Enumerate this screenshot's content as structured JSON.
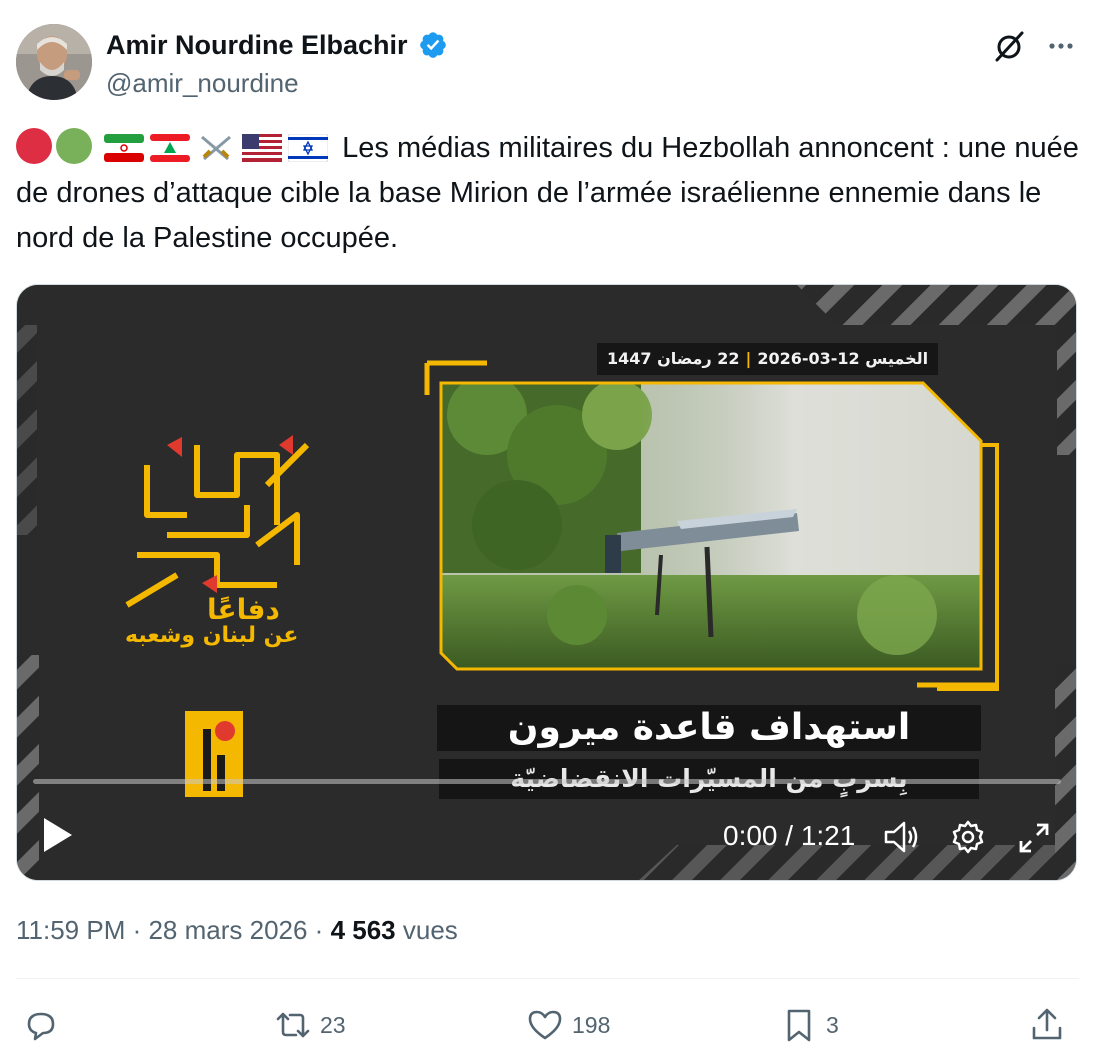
{
  "author": {
    "display_name": "Amir Nourdine Elbachir",
    "handle": "@amir_nourdine",
    "verified": true,
    "verified_color": "#1d9bf0"
  },
  "header_icons": {
    "grok": "grok-icon",
    "more": "more-icon"
  },
  "tweet": {
    "emoji_prefix": [
      "red-circle",
      "green-circle",
      "iran-flag",
      "lebanon-flag",
      "crossed-swords",
      "usa-flag",
      "israel-flag"
    ],
    "text": "Les médias militaires du Hezbollah annoncent : une nuée de drones d’attaque cible la base Mirion de l’armée israélienne ennemie dans le nord de la Palestine occupée."
  },
  "video": {
    "date_hijri": "22 رمضان 1447",
    "date_gregorian": "الخميس 12-03-2026",
    "title_ar": "استهداف قاعدة ميرون",
    "subtitle_ar": "بِسربٍ من المسيّرات الانقضاضيّة",
    "slogan_line1": "دفاعًا",
    "slogan_line2": "عن لبنان وشعبه",
    "current_time": "0:00",
    "duration": "1:21",
    "time_display": "0:00 / 1:21",
    "progress": 0,
    "accent_color": "#f5b800"
  },
  "meta": {
    "time": "11:59 PM",
    "date": "28 mars 2026",
    "views_count": "4 563",
    "views_label": "vues"
  },
  "actions": {
    "reply_count": "",
    "retweet_count": "23",
    "like_count": "198",
    "bookmark_count": "3"
  }
}
